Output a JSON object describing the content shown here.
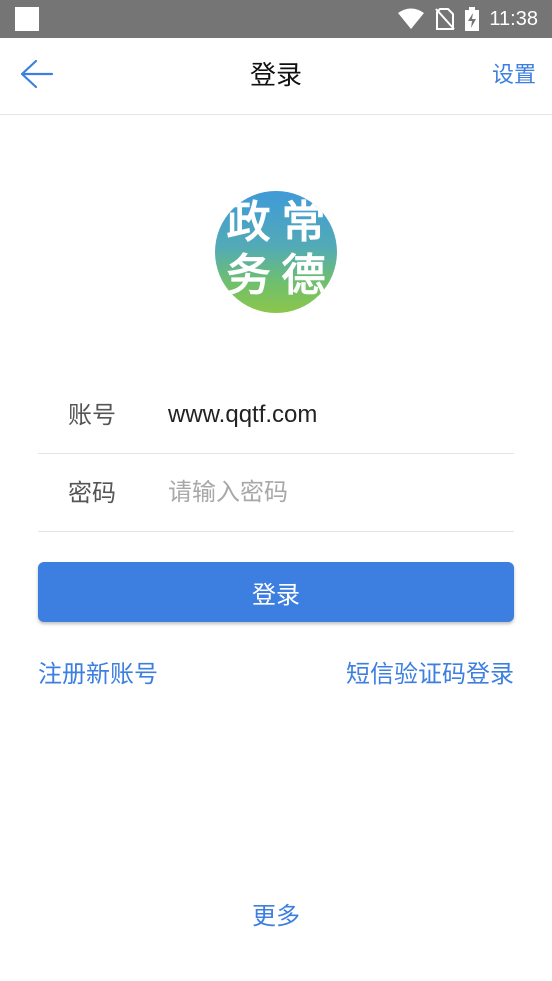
{
  "status_bar": {
    "time": "11:38",
    "icons": [
      "notification-square-icon",
      "wifi-icon",
      "no-sim-icon",
      "battery-charging-icon"
    ]
  },
  "app_bar": {
    "back_icon": "arrow-left-icon",
    "title": "登录",
    "settings_label": "设置"
  },
  "logo": {
    "chars": [
      "政",
      "常",
      "务",
      "德"
    ]
  },
  "form": {
    "account_label": "账号",
    "account_value": "www.qqtf.com",
    "password_label": "密码",
    "password_placeholder": "请输入密码"
  },
  "actions": {
    "login_label": "登录",
    "register_label": "注册新账号",
    "sms_login_label": "短信验证码登录",
    "more_label": "更多"
  },
  "colors": {
    "accent": "#3d7fe0",
    "status_bar": "#757575"
  }
}
